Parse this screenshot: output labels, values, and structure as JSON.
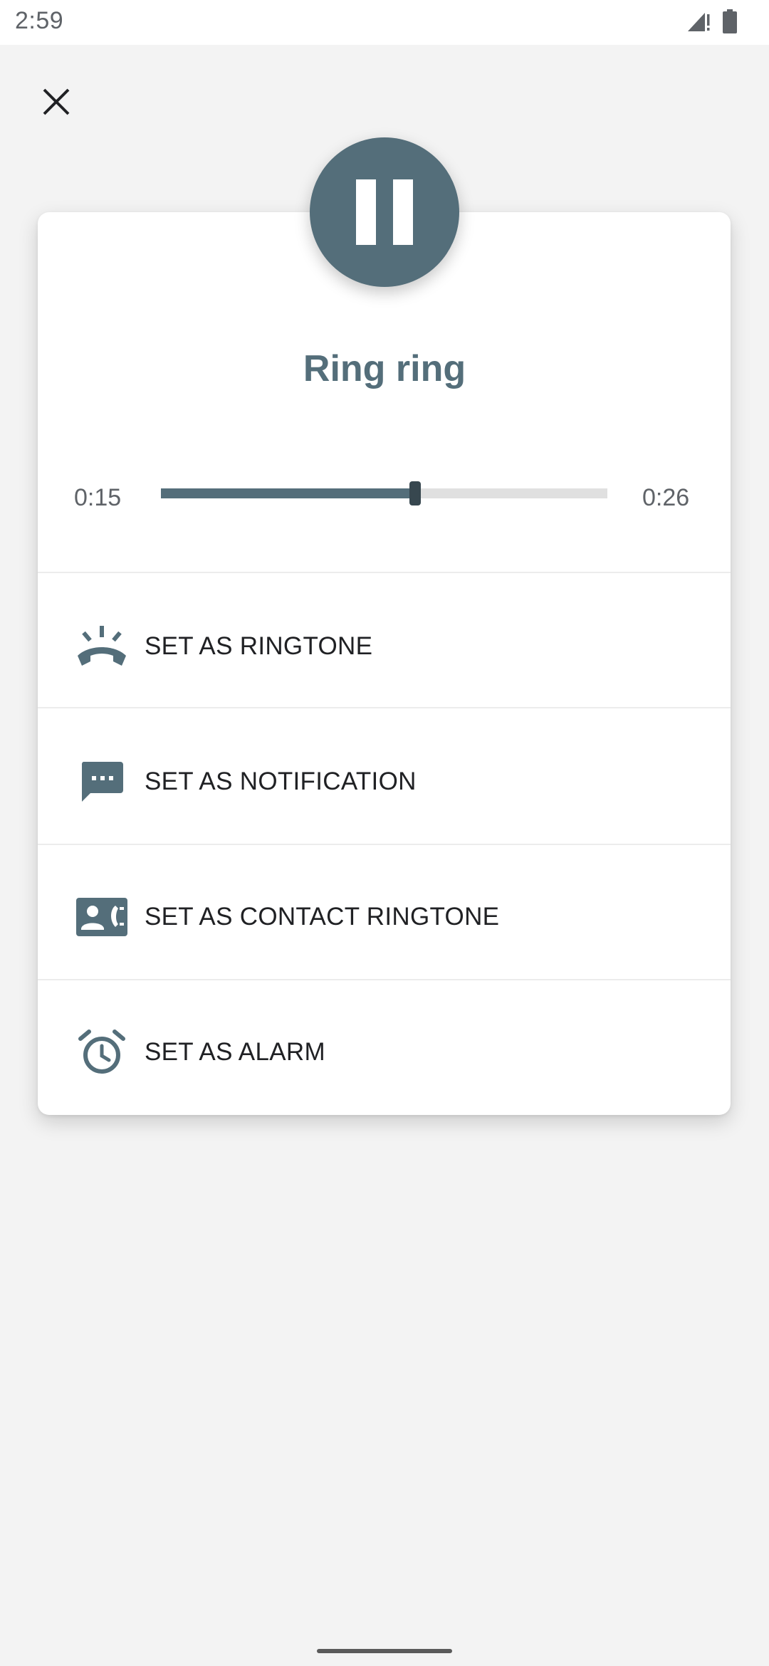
{
  "status_bar": {
    "time": "2:59"
  },
  "player": {
    "title": "Ring ring",
    "elapsed": "0:15",
    "duration": "0:26",
    "progress_fraction": 0.57,
    "state": "playing"
  },
  "options": [
    {
      "label": "SET AS RINGTONE",
      "icon": "phone-ringing-icon"
    },
    {
      "label": "SET AS NOTIFICATION",
      "icon": "message-icon"
    },
    {
      "label": "SET AS CONTACT RINGTONE",
      "icon": "contact-phone-icon"
    },
    {
      "label": "SET AS ALARM",
      "icon": "alarm-clock-icon"
    }
  ],
  "colors": {
    "accent": "#546e7a",
    "icon": "#546e7a",
    "background": "#f3f3f3",
    "card": "#ffffff"
  }
}
